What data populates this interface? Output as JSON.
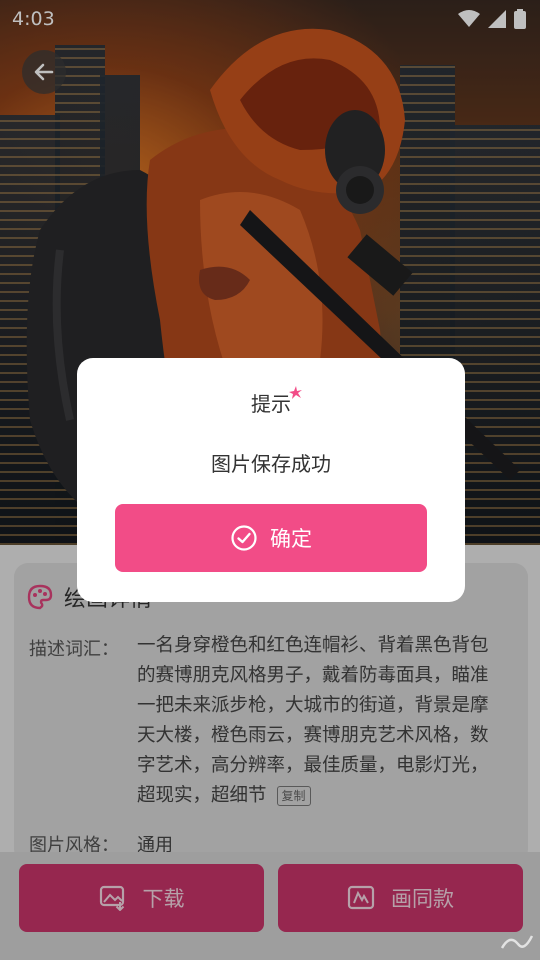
{
  "status_bar": {
    "time": "4:03",
    "icons": [
      "wifi-icon",
      "signal-icon",
      "battery-icon"
    ]
  },
  "hero": {
    "description": "Cyberpunk soldier in orange hood with gas mask and rifle, city skyline background"
  },
  "card": {
    "title": "绘画详情",
    "description_label": "描述词汇：",
    "description_text": "一名身穿橙色和红色连帽衫、背着黑色背包的赛博朋克风格男子，戴着防毒面具，瞄准一把未来派步枪，大城市的街道，背景是摩天大楼，橙色雨云，赛博朋克艺术风格，数字艺术，高分辨率，最佳质量，电影灯光，超现实，超细节",
    "copy_label": "复制",
    "style_label": "图片风格：",
    "style_value": "通用"
  },
  "actions": {
    "download_label": "下载",
    "draw_same_label": "画同款"
  },
  "dialog": {
    "title": "提示",
    "message": "图片保存成功",
    "confirm_label": "确定"
  },
  "colors": {
    "accent": "#f24c87",
    "bottom_button": "#c8346a",
    "card_bg": "#d8d8d8"
  }
}
